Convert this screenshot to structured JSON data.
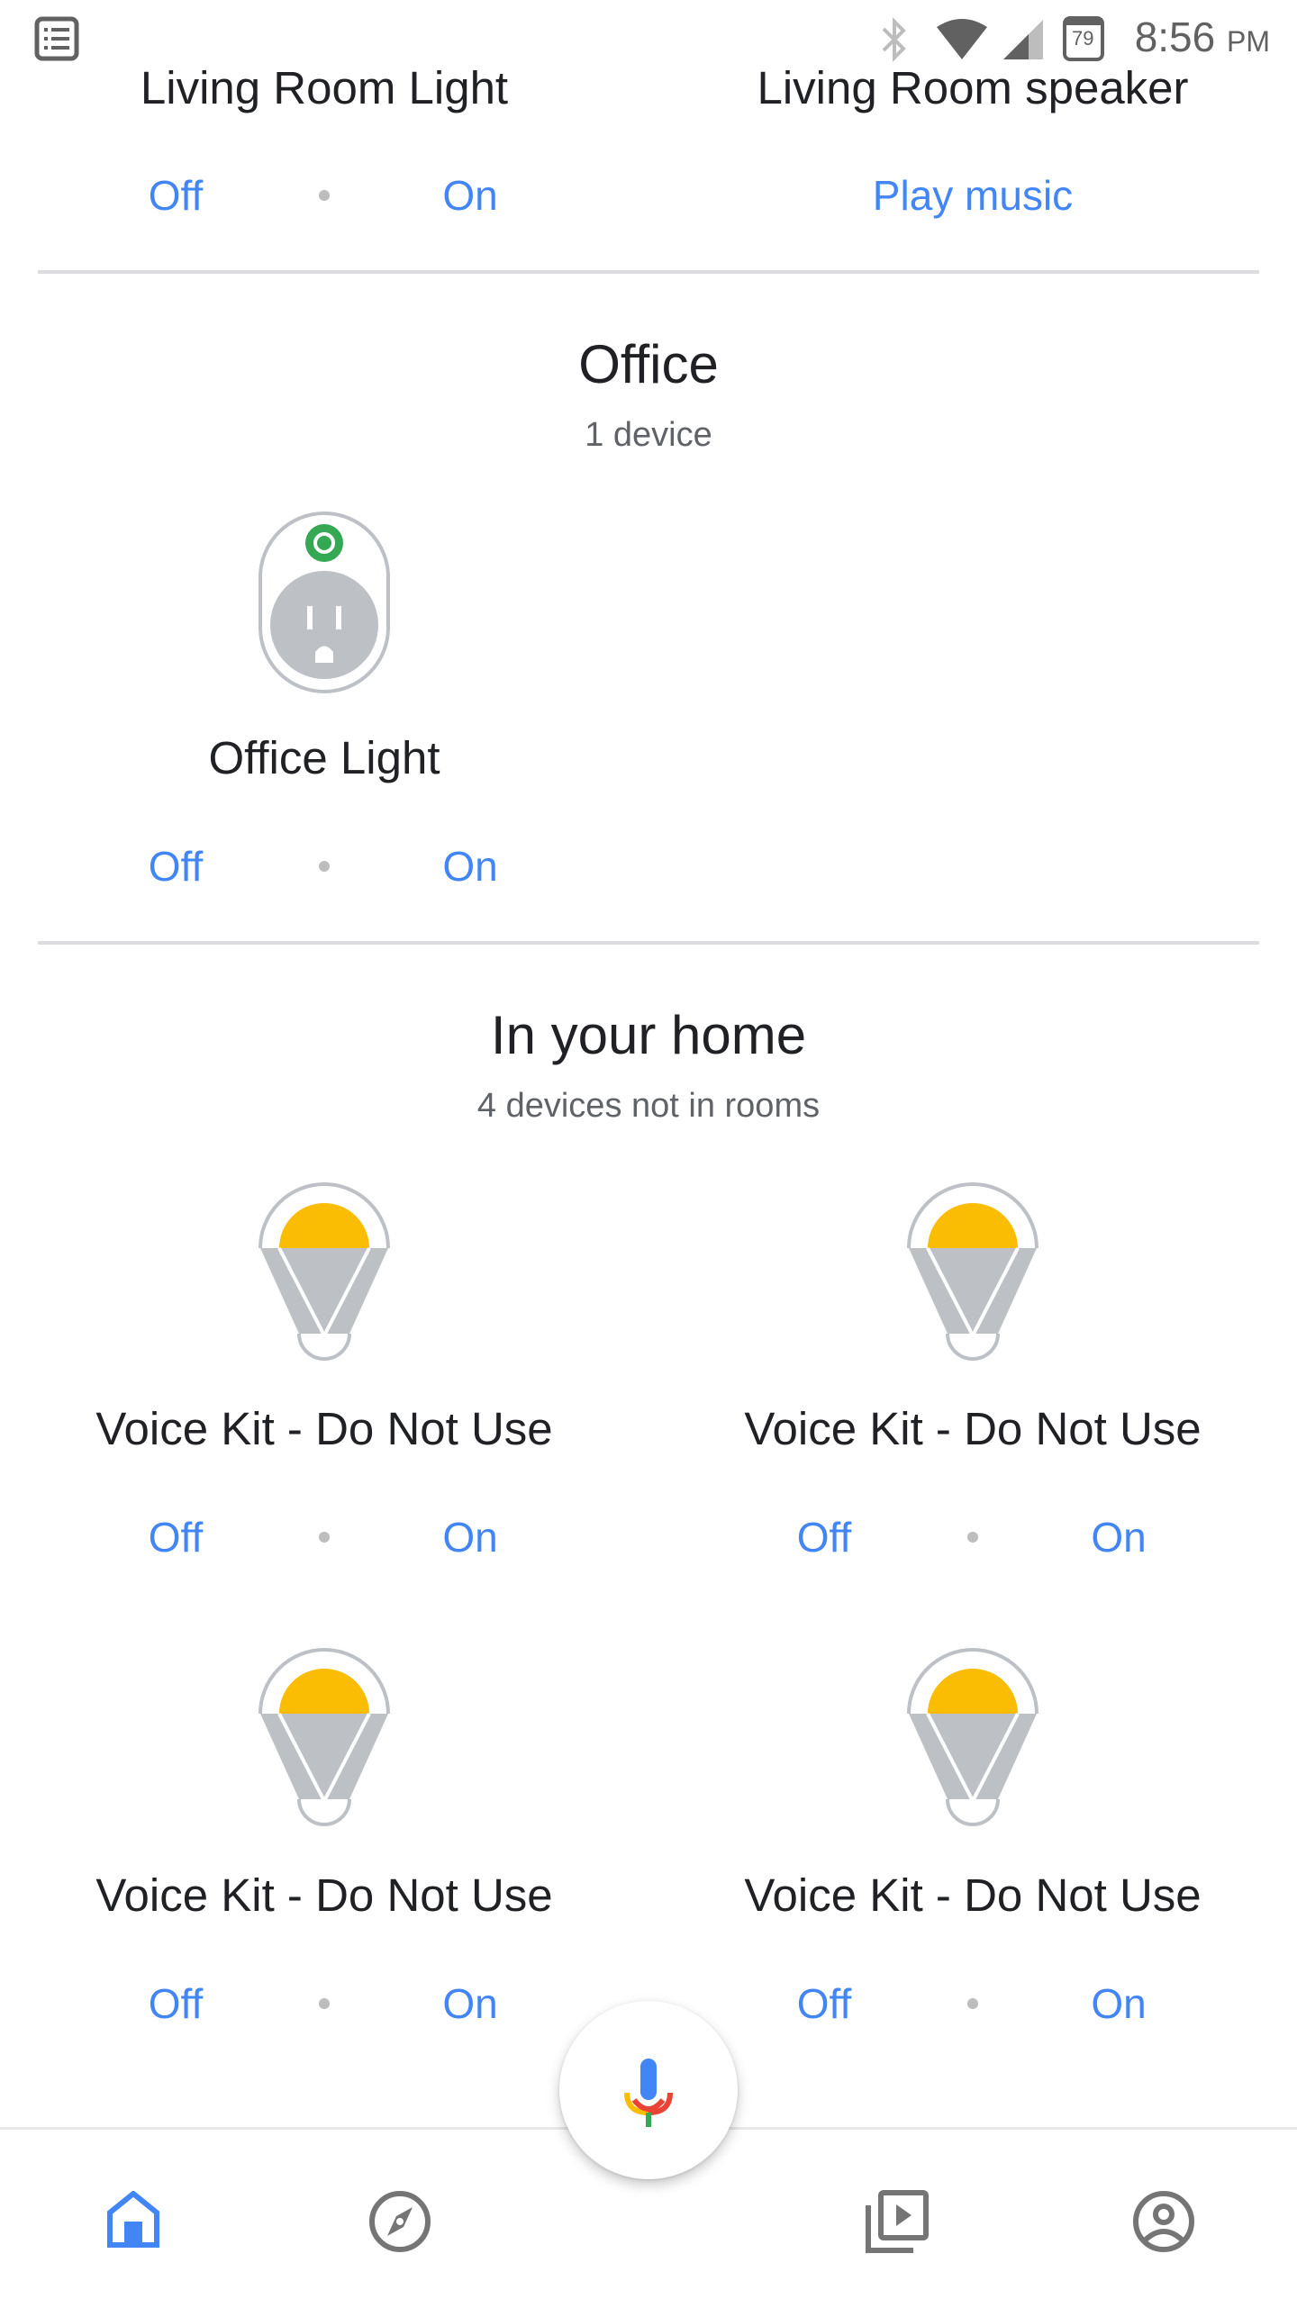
{
  "status_bar": {
    "notification_icon": "task-list-icon",
    "icons": [
      "bluetooth-icon",
      "wifi-icon",
      "cell-signal-icon",
      "calendar-icon"
    ],
    "calendar_day": "79",
    "time": "8:56",
    "ampm": "PM"
  },
  "colors": {
    "accent": "#4285f4",
    "text_primary": "#202124",
    "text_secondary": "#5f6368",
    "divider": "#dadce0",
    "bulb_yellow": "#fbbc04",
    "device_gray": "#bdc1c6",
    "status_green": "#34a853"
  },
  "living_room": {
    "devices": [
      {
        "name": "Living Room Light",
        "actions": [
          "Off",
          "On"
        ]
      },
      {
        "name": "Living Room speaker",
        "actions": [
          "Play music"
        ]
      }
    ]
  },
  "office": {
    "title": "Office",
    "subtitle": "1 device",
    "devices": [
      {
        "name": "Office Light",
        "icon": "smart-plug-icon",
        "actions": [
          "Off",
          "On"
        ]
      }
    ]
  },
  "home": {
    "title": "In your home",
    "subtitle": "4 devices not in rooms",
    "devices": [
      {
        "name": "Voice Kit - Do Not Use",
        "icon": "light-bulb-icon",
        "actions": [
          "Off",
          "On"
        ]
      },
      {
        "name": "Voice Kit - Do Not Use",
        "icon": "light-bulb-icon",
        "actions": [
          "Off",
          "On"
        ]
      },
      {
        "name": "Voice Kit - Do Not Use",
        "icon": "light-bulb-icon",
        "actions": [
          "Off",
          "On"
        ]
      },
      {
        "name": "Voice Kit - Do Not Use",
        "icon": "light-bulb-icon",
        "actions": [
          "Off",
          "On"
        ]
      }
    ]
  },
  "bottom_nav": {
    "items": [
      {
        "icon": "home-icon",
        "active": true
      },
      {
        "icon": "explore-compass-icon",
        "active": false
      },
      {
        "icon": "media-library-icon",
        "active": false
      },
      {
        "icon": "account-icon",
        "active": false
      }
    ],
    "fab_icon": "microphone-icon"
  }
}
